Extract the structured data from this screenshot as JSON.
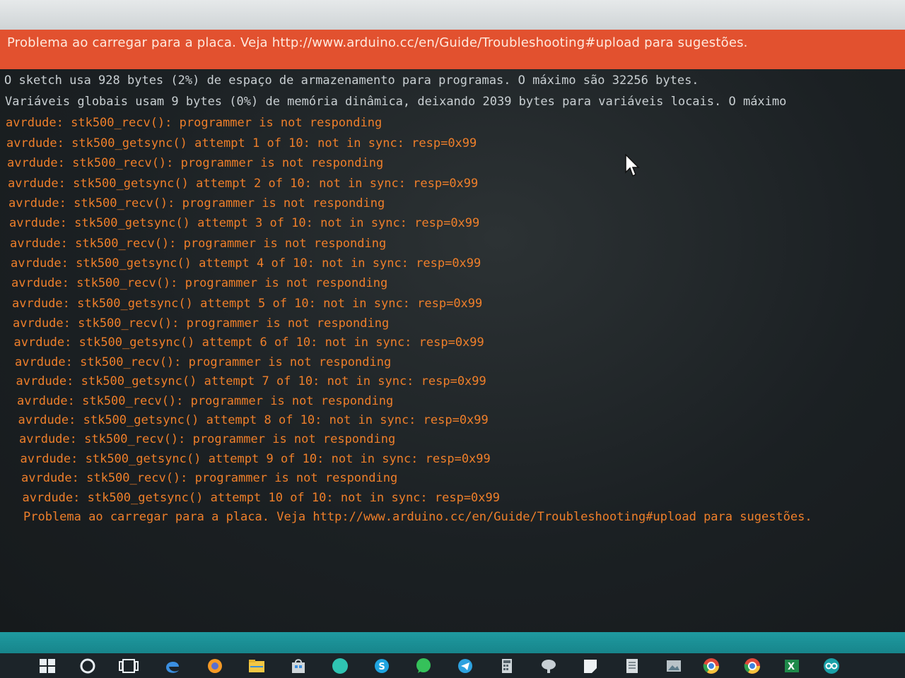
{
  "error_banner": {
    "message": "Problema ao carregar para a placa. Veja http://www.arduino.cc/en/Guide/Troubleshooting#upload para sugestões."
  },
  "console": {
    "lines": [
      {
        "type": "info",
        "text": "O sketch usa 928 bytes (2%) de espaço de armazenamento para programas. O máximo são 32256 bytes."
      },
      {
        "type": "info",
        "text": "Variáveis globais usam 9 bytes (0%) de memória dinâmica, deixando 2039 bytes para variáveis locais. O máximo"
      },
      {
        "type": "err",
        "text": "avrdude: stk500_recv(): programmer is not responding"
      },
      {
        "type": "err",
        "text": "avrdude: stk500_getsync() attempt 1 of 10: not in sync: resp=0x99"
      },
      {
        "type": "err",
        "text": "avrdude: stk500_recv(): programmer is not responding"
      },
      {
        "type": "err",
        "text": "avrdude: stk500_getsync() attempt 2 of 10: not in sync: resp=0x99"
      },
      {
        "type": "err",
        "text": "avrdude: stk500_recv(): programmer is not responding"
      },
      {
        "type": "err",
        "text": "avrdude: stk500_getsync() attempt 3 of 10: not in sync: resp=0x99"
      },
      {
        "type": "err",
        "text": "avrdude: stk500_recv(): programmer is not responding"
      },
      {
        "type": "err",
        "text": "avrdude: stk500_getsync() attempt 4 of 10: not in sync: resp=0x99"
      },
      {
        "type": "err",
        "text": "avrdude: stk500_recv(): programmer is not responding"
      },
      {
        "type": "err",
        "text": "avrdude: stk500_getsync() attempt 5 of 10: not in sync: resp=0x99"
      },
      {
        "type": "err",
        "text": "avrdude: stk500_recv(): programmer is not responding"
      },
      {
        "type": "err",
        "text": "avrdude: stk500_getsync() attempt 6 of 10: not in sync: resp=0x99"
      },
      {
        "type": "err",
        "text": "avrdude: stk500_recv(): programmer is not responding"
      },
      {
        "type": "err",
        "text": "avrdude: stk500_getsync() attempt 7 of 10: not in sync: resp=0x99"
      },
      {
        "type": "err",
        "text": "avrdude: stk500_recv(): programmer is not responding"
      },
      {
        "type": "err",
        "text": "avrdude: stk500_getsync() attempt 8 of 10: not in sync: resp=0x99"
      },
      {
        "type": "err",
        "text": "avrdude: stk500_recv(): programmer is not responding"
      },
      {
        "type": "err",
        "text": "avrdude: stk500_getsync() attempt 9 of 10: not in sync: resp=0x99"
      },
      {
        "type": "err",
        "text": "avrdude: stk500_recv(): programmer is not responding"
      },
      {
        "type": "err",
        "text": "avrdude: stk500_getsync() attempt 10 of 10: not in sync: resp=0x99"
      },
      {
        "type": "err",
        "text": "Problema ao carregar para a placa. Veja http://www.arduino.cc/en/Guide/Troubleshooting#upload para sugestões."
      }
    ]
  },
  "colors": {
    "error_banner": "#e2512f",
    "console_background": "#1b2023",
    "info_text": "#c9cfd2",
    "error_text": "#ef7f2a",
    "status_strip": "#1f9aa0",
    "taskbar": "#1c2429"
  },
  "taskbar": {
    "icons": [
      "windows-start-icon",
      "cortana-search-icon",
      "task-view-icon",
      "edge-browser-icon",
      "firefox-icon",
      "file-explorer-icon",
      "store-icon",
      "app-circle-icon",
      "skype-icon",
      "whatsapp-icon",
      "telegram-icon",
      "calculator-icon",
      "network-app-icon",
      "sticky-notes-icon",
      "document-app-icon",
      "photos-app-icon",
      "chrome-icon",
      "chrome-alt-icon",
      "excel-icon",
      "arduino-ide-icon"
    ]
  }
}
